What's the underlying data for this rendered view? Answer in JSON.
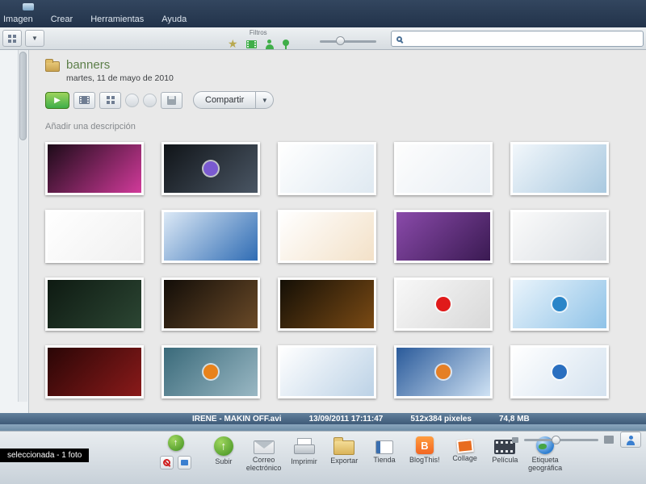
{
  "menu": {
    "items": [
      "Imagen",
      "Crear",
      "Herramientas",
      "Ayuda"
    ]
  },
  "toolbar": {
    "filters_label": "Filtros",
    "search_value": ""
  },
  "folder": {
    "title": "banners",
    "date": "martes, 11 de mayo de 2010",
    "share_label": "Compartir",
    "description": "Añadir una descripción"
  },
  "statusbar": {
    "filename": "IRENE - MAKIN OFF.avi",
    "datetime": "13/09/2011 17:11:47",
    "dimensions": "512x384 pixeles",
    "filesize": "74,8 MB"
  },
  "tray": {
    "selection_text": "seleccionada - 1 foto"
  },
  "actions": [
    {
      "label": "Subir",
      "icon": "upload"
    },
    {
      "label": "Correo electrónico",
      "icon": "mail"
    },
    {
      "label": "Imprimir",
      "icon": "print"
    },
    {
      "label": "Exportar",
      "icon": "export"
    },
    {
      "label": "Tienda",
      "icon": "shop"
    },
    {
      "label": "BlogThis!",
      "icon": "blog"
    },
    {
      "label": "Collage",
      "icon": "collage"
    },
    {
      "label": "Película",
      "icon": "movie"
    },
    {
      "label": "Etiqueta geográfica",
      "icon": "geo"
    }
  ],
  "thumbnails": [
    {
      "name": "proza-banner",
      "c1": "#1c0b18",
      "c2": "#d13a9a"
    },
    {
      "name": "desktop-theme",
      "c1": "#101418",
      "c2": "#4a5664",
      "accent": "#7a5ad0"
    },
    {
      "name": "eboostr-setup",
      "c1": "#ffffff",
      "c2": "#dfe9f1"
    },
    {
      "name": "avg-installer",
      "c1": "#fdfdfd",
      "c2": "#e8eef4"
    },
    {
      "name": "zune-pages",
      "c1": "#f2f7fb",
      "c2": "#a9c9e0"
    },
    {
      "name": "google-search",
      "c1": "#ffffff",
      "c2": "#f0f0f0"
    },
    {
      "name": "blue-portal",
      "c1": "#dce9f6",
      "c2": "#2f6cb4"
    },
    {
      "name": "forum-page",
      "c1": "#ffffff",
      "c2": "#f3e1c8"
    },
    {
      "name": "purple-cartoon",
      "c1": "#8a4aaa",
      "c2": "#3a1a52"
    },
    {
      "name": "contact-sheet",
      "c1": "#fbfbfb",
      "c2": "#d8dde2"
    },
    {
      "name": "dark-gallery",
      "c1": "#0e1a12",
      "c2": "#2c4633"
    },
    {
      "name": "dark-messiah",
      "c1": "#120d08",
      "c2": "#6a4a28"
    },
    {
      "name": "temple-game",
      "c1": "#140f06",
      "c2": "#7a4a14"
    },
    {
      "name": "opera-page",
      "c1": "#f8f8f8",
      "c2": "#d8d8d8",
      "accent": "#e01a1a"
    },
    {
      "name": "byki-card",
      "c1": "#eaf4fb",
      "c2": "#8fc3e8",
      "accent": "#2a85c8"
    },
    {
      "name": "red-website",
      "c1": "#2a0606",
      "c2": "#8a1a1a"
    },
    {
      "name": "vlc-photo",
      "c1": "#3a6a7a",
      "c2": "#9ab8c4",
      "accent": "#e8821a"
    },
    {
      "name": "blue-docs",
      "c1": "#ffffff",
      "c2": "#bcd2e6"
    },
    {
      "name": "firefox-page",
      "c1": "#2a5a9a",
      "c2": "#cfe2f4",
      "accent": "#e57f25"
    },
    {
      "name": "thunderbird-page",
      "c1": "#ffffff",
      "c2": "#d4e2ef",
      "accent": "#2a6fc0"
    }
  ],
  "colors": {
    "accent_green": "#3fae49",
    "menubar_top": "#33465f",
    "menubar_bottom": "#22334a",
    "statusbar": "#3e5a78"
  }
}
